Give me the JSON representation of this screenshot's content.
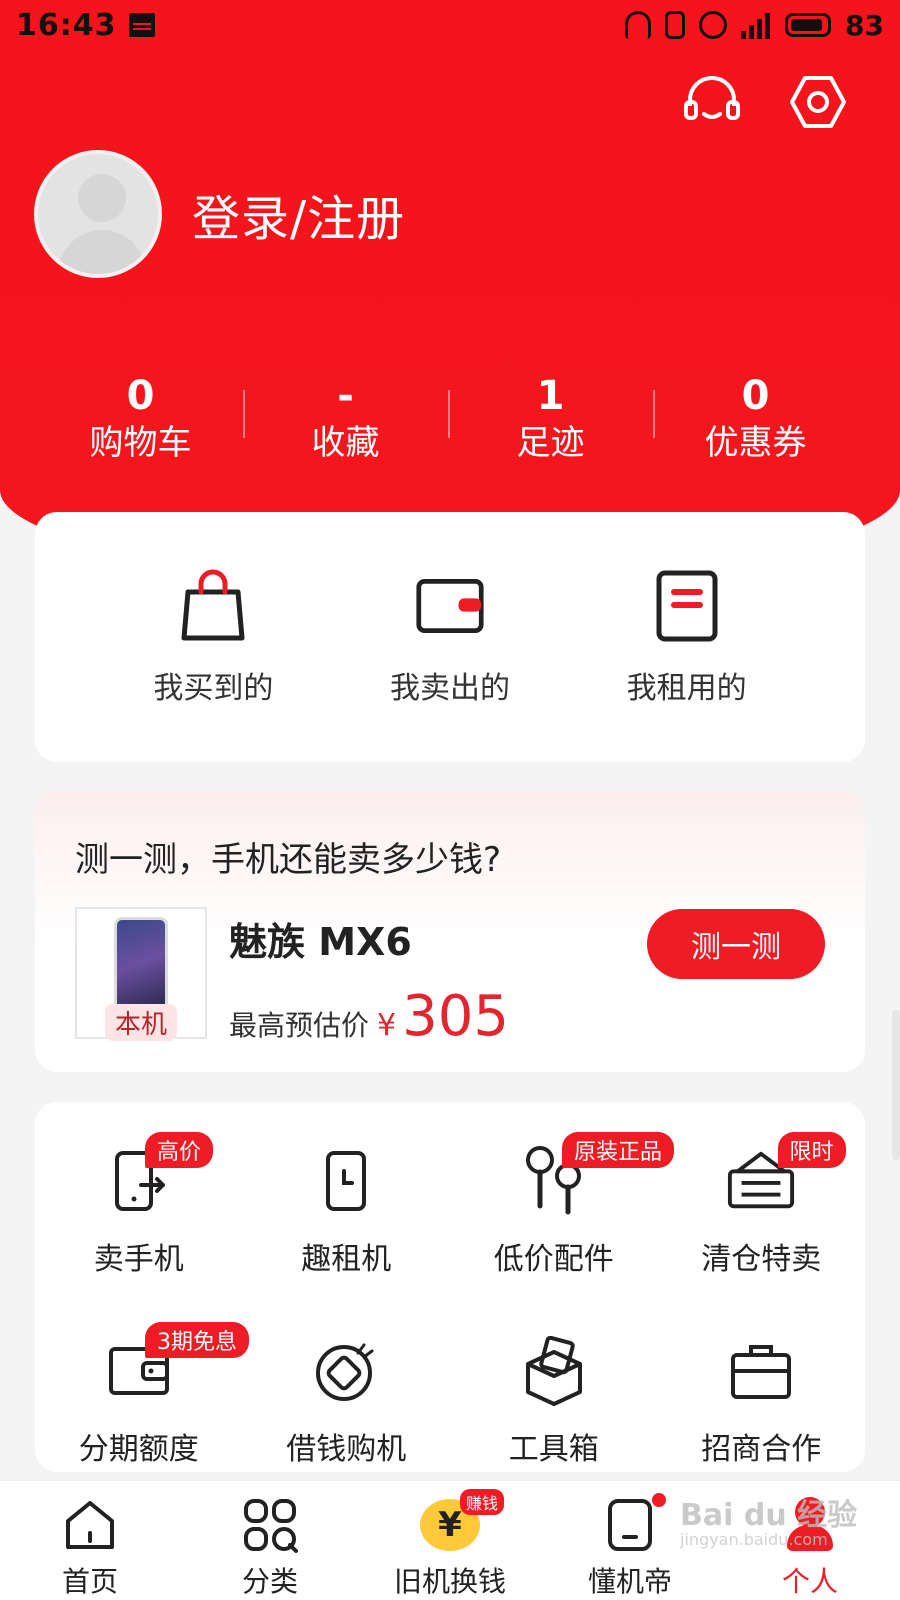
{
  "status_bar": {
    "time": "16:43",
    "battery": "83",
    "network": "4G"
  },
  "header": {
    "login_text": "登录/注册"
  },
  "stats": [
    {
      "value": "0",
      "label": "购物车"
    },
    {
      "value": "-",
      "label": "收藏"
    },
    {
      "value": "1",
      "label": "足迹"
    },
    {
      "value": "0",
      "label": "优惠券"
    }
  ],
  "orders": [
    {
      "label": "我买到的",
      "icon": "shopping-bag-icon"
    },
    {
      "label": "我卖出的",
      "icon": "wallet-card-icon"
    },
    {
      "label": "我租用的",
      "icon": "document-icon"
    }
  ],
  "estimate": {
    "title": "测一测，手机还能卖多少钱?",
    "model": "魅族 MX6",
    "tag": "本机",
    "price_label": "最高预估价",
    "currency": "¥",
    "price": "305",
    "button": "测一测"
  },
  "services": [
    {
      "label": "卖手机",
      "badge": "高价",
      "icon": "sell-phone-icon"
    },
    {
      "label": "趣租机",
      "badge": "",
      "icon": "rent-phone-icon"
    },
    {
      "label": "低价配件",
      "badge": "原装正品",
      "icon": "earbuds-icon"
    },
    {
      "label": "清仓特卖",
      "badge": "限时",
      "icon": "clearance-sign-icon"
    },
    {
      "label": "分期额度",
      "badge": "3期免息",
      "icon": "wallet-icon"
    },
    {
      "label": "借钱购机",
      "badge": "",
      "icon": "loan-coin-icon"
    },
    {
      "label": "工具箱",
      "badge": "",
      "icon": "toolbox-icon"
    },
    {
      "label": "招商合作",
      "badge": "",
      "icon": "briefcase-icon"
    }
  ],
  "tabbar": [
    {
      "label": "首页",
      "icon": "home-icon"
    },
    {
      "label": "分类",
      "icon": "category-icon"
    },
    {
      "label": "旧机换钱",
      "icon": "yen-icon",
      "badge": "赚钱"
    },
    {
      "label": "懂机帝",
      "icon": "phone-icon"
    },
    {
      "label": "个人",
      "icon": "person-icon"
    }
  ],
  "watermark": {
    "text": "Bai du 经验",
    "sub": "jingyan.baidu.com"
  },
  "colors": {
    "brand_red": "#ee1c24",
    "price_red": "#e3262d",
    "badge_yellow": "#ffc93a"
  }
}
